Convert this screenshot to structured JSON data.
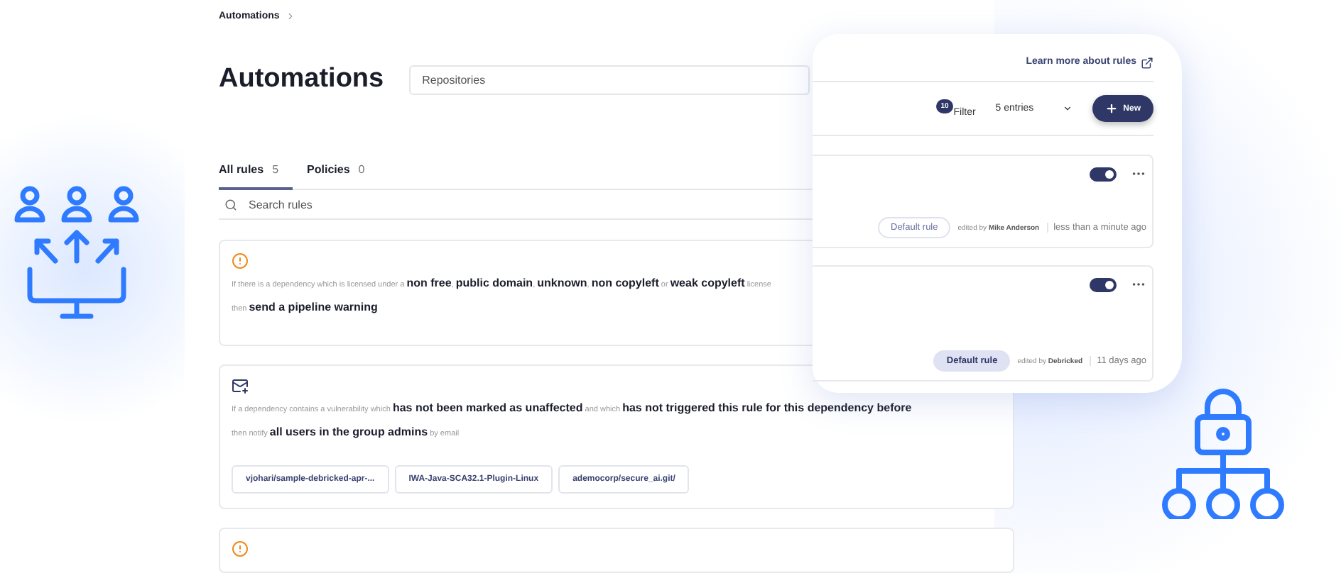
{
  "breadcrumb": [
    {
      "label": "Automations"
    }
  ],
  "title": "Automations",
  "repository_filter": {
    "placeholder": "Repositories"
  },
  "tabs": [
    {
      "label": "All rules",
      "count": "5",
      "selected": true
    },
    {
      "label": "Policies",
      "count": "0",
      "selected": false
    }
  ],
  "search": {
    "placeholder": "Search rules"
  },
  "rules": [
    {
      "kind": "warning",
      "lines": [
        "If there is a dependency which is licensed under a **non free**, **public domain**, **unknown**, **non copyleft** or **weak copyleft** license",
        "then **send a pipeline warning**"
      ]
    },
    {
      "kind": "email",
      "lines": [
        "If a dependency contains a vulnerability which **has not been marked as unaffected** and which **has not triggered this rule for this dependency before**",
        "then notify **all users in the group admins** by email"
      ],
      "repositories": [
        "vjohari/sample-debricked-apr-...",
        "IWA-Java-SCA32.1-Plugin-Linux",
        "ademocorp/secure_ai.git/"
      ]
    },
    {
      "kind": "warning"
    }
  ],
  "panel": {
    "learn_more_link": "Learn more about rules",
    "filter": {
      "badge": "10",
      "label": "Filter"
    },
    "entries_select": {
      "value": "5 entries"
    },
    "new_button": "New",
    "rules": [
      {
        "on": true,
        "tag": "Default rule",
        "tag_highlighted": false,
        "edited_prefix": "edited by",
        "editor": "Mike Anderson",
        "time": "less than a minute ago"
      },
      {
        "on": true,
        "tag": "Default rule",
        "tag_highlighted": true,
        "edited_prefix": "edited by",
        "editor": "Debricked",
        "time": "11 days ago"
      }
    ]
  }
}
